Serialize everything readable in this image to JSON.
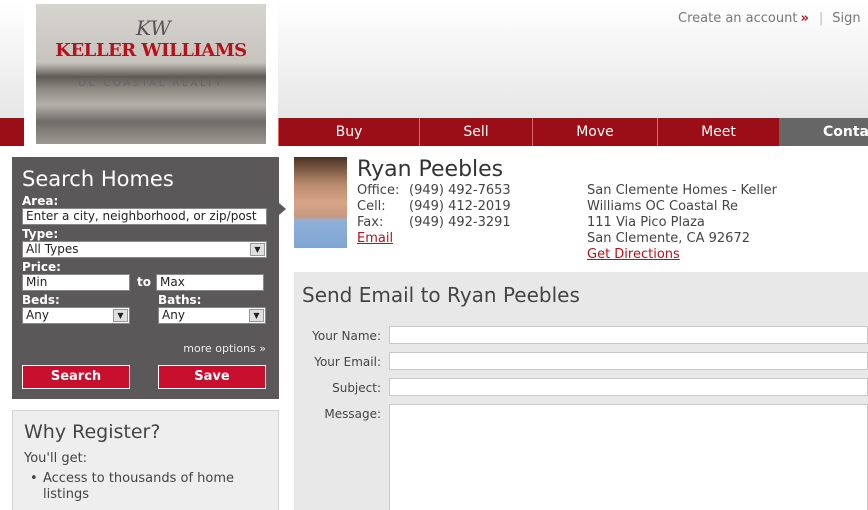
{
  "logo": {
    "mark": "KW",
    "title": "KELLER WILLIAMS",
    "subtitle": "OC COASTAL REALTY"
  },
  "top_links": {
    "create_account": "Create an account",
    "arrow": "»",
    "separator": "|",
    "sign_in": "Sign"
  },
  "nav": {
    "items": [
      "Buy",
      "Sell",
      "Move",
      "Meet",
      "Conta"
    ]
  },
  "search": {
    "title": "Search Homes",
    "area_label": "Area:",
    "area_placeholder": "Enter a city, neighborhood, or zip/post",
    "type_label": "Type:",
    "type_value": "All Types",
    "price_label": "Price:",
    "price_min": "Min",
    "price_to": "to",
    "price_max": "Max",
    "beds_label": "Beds:",
    "beds_value": "Any",
    "baths_label": "Baths:",
    "baths_value": "Any",
    "more_options": "more options »",
    "search_button": "Search",
    "save_button": "Save"
  },
  "register": {
    "title": "Why Register?",
    "intro": "You'll get:",
    "items": [
      "Access to thousands of home listings"
    ]
  },
  "agent": {
    "name": "Ryan Peebles",
    "office_label": "Office:",
    "office_phone": "(949) 492-7653",
    "cell_label": "Cell:",
    "cell_phone": "(949) 412-2019",
    "fax_label": "Fax:",
    "fax_phone": "(949) 492-3291",
    "email_link": "Email",
    "office_name_1": "San Clemente Homes - Keller",
    "office_name_2": "Williams OC Coastal Re",
    "address_1": "111 Via Pico Plaza",
    "address_2": "San Clemente, CA 92672",
    "directions_link": "Get Directions"
  },
  "email_form": {
    "title": "Send Email to Ryan Peebles",
    "name_label": "Your Name:",
    "email_label": "Your Email:",
    "subject_label": "Subject:",
    "message_label": "Message:"
  },
  "colors": {
    "brand_red": "#9b0e17",
    "button_red": "#c8102e",
    "link_red": "#b5121b",
    "panel_dark": "#5a5858"
  }
}
